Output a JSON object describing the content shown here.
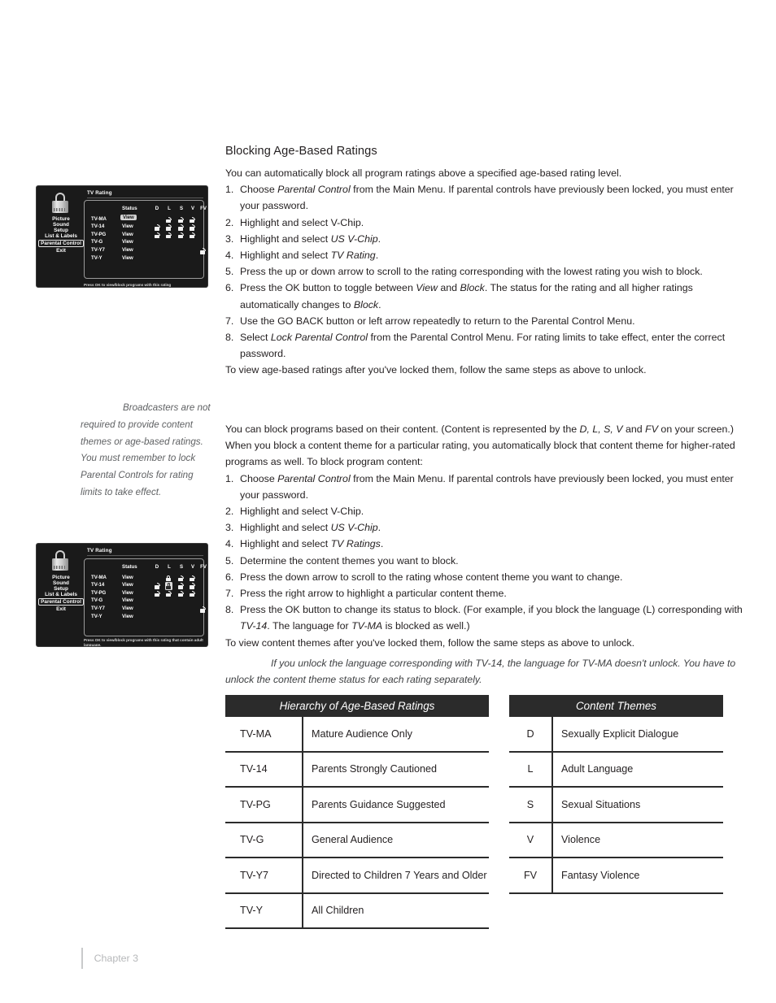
{
  "page": {
    "footer_chapter": "Chapter 3"
  },
  "section": {
    "heading": "Blocking Age-Based Ratings",
    "intro": "You can automatically block all program ratings above a specified age-based rating level.",
    "steps": [
      "Choose <i>Parental Control</i> from the Main Menu. If parental controls have previously been locked, you must enter your password.",
      "Highlight and select V-Chip.",
      "Highlight and select <i>US V-Chip</i>.",
      "Highlight and select <i>TV Rating</i>.",
      "Press the up or down arrow to scroll to the rating corresponding with the lowest rating you wish to block.",
      "Press the OK button to toggle between <i>View</i> and <i>Block</i>. The status for the rating and all higher ratings automatically changes to <i>Block</i>.",
      "Use the GO BACK button or left arrow repeatedly to return to the Parental Control Menu.",
      "Select <i>Lock Parental Control</i> from the Parental Control Menu. For rating limits to take effect, enter the correct password."
    ],
    "closing": "To view age-based ratings after you've locked them, follow the same steps as above to unlock."
  },
  "section2": {
    "intro": "You can block programs based on their content. (Content is represented by the <i>D, L, S, V</i> and <i>FV</i> on your screen.) When you block a content theme for a particular rating, you automatically block that content theme for higher-rated programs as well. To block program content:",
    "steps": [
      "Choose <i>Parental Control</i> from the Main Menu. If parental controls have previously been locked, you must enter your password.",
      "Highlight and select V-Chip.",
      "Highlight and select <i>US V-Chip</i>.",
      "Highlight and select <i>TV Ratings</i>.",
      "Determine the content themes you want to block.",
      "Press the down arrow to scroll to the rating whose content theme you want to change.",
      "Press the right arrow to highlight a particular content theme.",
      "Press the OK button to change its status to block. (For example, if you block the language (L) corresponding with <i>TV-14</i>. The language for <i>TV-MA</i> is blocked as well.)"
    ],
    "closing": "To view content themes after you've locked them, follow the same steps as above to unlock.",
    "note": "If you unlock the language corresponding with TV-14, the language for TV-MA doesn't unlock. You have to unlock the content theme status for each rating separately."
  },
  "margin_note": {
    "text": "Broadcasters are not required to provide content themes or age-based ratings. You must remember to lock Parental Controls for rating limits to take effect."
  },
  "tv_screenshot_1": {
    "title": "TV Rating",
    "lock_icon": "padlock-icon",
    "menu": [
      "Picture",
      "Sound",
      "Setup",
      "List & Labels",
      "Parental Control",
      "Exit"
    ],
    "menu_selected": "Parental Control",
    "columns": [
      "Status",
      "D",
      "L",
      "S",
      "V",
      "FV"
    ],
    "rows": [
      {
        "rating": "TV-MA",
        "status": "View",
        "status_highlighted": true,
        "marks": {
          "D": "",
          "L": "open",
          "S": "open",
          "V": "open",
          "FV": ""
        }
      },
      {
        "rating": "TV-14",
        "status": "View",
        "status_highlighted": false,
        "marks": {
          "D": "open",
          "L": "open",
          "S": "open",
          "V": "open",
          "FV": ""
        }
      },
      {
        "rating": "TV-PG",
        "status": "View",
        "status_highlighted": false,
        "marks": {
          "D": "open",
          "L": "open",
          "S": "open",
          "V": "open",
          "FV": ""
        }
      },
      {
        "rating": "TV-G",
        "status": "View",
        "status_highlighted": false,
        "marks": {
          "D": "",
          "L": "",
          "S": "",
          "V": "",
          "FV": ""
        }
      },
      {
        "rating": "TV-Y7",
        "status": "View",
        "status_highlighted": false,
        "marks": {
          "D": "",
          "L": "",
          "S": "",
          "V": "",
          "FV": "open"
        }
      },
      {
        "rating": "TV-Y",
        "status": "View",
        "status_highlighted": false,
        "marks": {
          "D": "",
          "L": "",
          "S": "",
          "V": "",
          "FV": ""
        }
      }
    ],
    "caption": "Press OK  to view/block programs with this rating"
  },
  "tv_screenshot_2": {
    "title": "TV Rating",
    "lock_icon": "padlock-icon",
    "menu": [
      "Picture",
      "Sound",
      "Setup",
      "List & Labels",
      "Parental Control",
      "Exit"
    ],
    "menu_selected": "Parental Control",
    "columns": [
      "Status",
      "D",
      "L",
      "S",
      "V",
      "FV"
    ],
    "rows": [
      {
        "rating": "TV-MA",
        "status": "View",
        "status_highlighted": false,
        "marks": {
          "D": "",
          "L": "closed",
          "S": "open",
          "V": "open",
          "FV": ""
        }
      },
      {
        "rating": "TV-14",
        "status": "View",
        "status_highlighted": false,
        "marks": {
          "D": "open",
          "L": "selected",
          "S": "open",
          "V": "open",
          "FV": ""
        }
      },
      {
        "rating": "TV-PG",
        "status": "View",
        "status_highlighted": false,
        "marks": {
          "D": "open",
          "L": "open",
          "S": "open",
          "V": "open",
          "FV": ""
        }
      },
      {
        "rating": "TV-G",
        "status": "View",
        "status_highlighted": false,
        "marks": {
          "D": "",
          "L": "",
          "S": "",
          "V": "",
          "FV": ""
        }
      },
      {
        "rating": "TV-Y7",
        "status": "View",
        "status_highlighted": false,
        "marks": {
          "D": "",
          "L": "",
          "S": "",
          "V": "",
          "FV": "open"
        }
      },
      {
        "rating": "TV-Y",
        "status": "View",
        "status_highlighted": false,
        "marks": {
          "D": "",
          "L": "",
          "S": "",
          "V": "",
          "FV": ""
        }
      }
    ],
    "caption": "Press OK  to view/block programs with this rating that contain adult language."
  },
  "table_hierarchy": {
    "title": "Hierarchy of Age-Based Ratings",
    "rows": [
      {
        "key": "TV-MA",
        "value": "Mature Audience Only"
      },
      {
        "key": "TV-14",
        "value": "Parents Strongly Cautioned"
      },
      {
        "key": "TV-PG",
        "value": "Parents Guidance Suggested"
      },
      {
        "key": "TV-G",
        "value": "General Audience"
      },
      {
        "key": "TV-Y7",
        "value": "Directed to Children 7 Years and Older"
      },
      {
        "key": "TV-Y",
        "value": "All Children"
      }
    ]
  },
  "table_themes": {
    "title": "Content Themes",
    "rows": [
      {
        "key": "D",
        "value": "Sexually Explicit Dialogue"
      },
      {
        "key": "L",
        "value": "Adult Language"
      },
      {
        "key": "S",
        "value": "Sexual Situations"
      },
      {
        "key": "V",
        "value": "Violence"
      },
      {
        "key": "FV",
        "value": "Fantasy Violence"
      }
    ]
  },
  "colors": {
    "table_header_bg": "#2b2b2b",
    "tv_bg": "#1a1a1a",
    "text": "#231f20",
    "margin_note_text": "#5f6163",
    "footer_text": "#b6b8ba"
  }
}
